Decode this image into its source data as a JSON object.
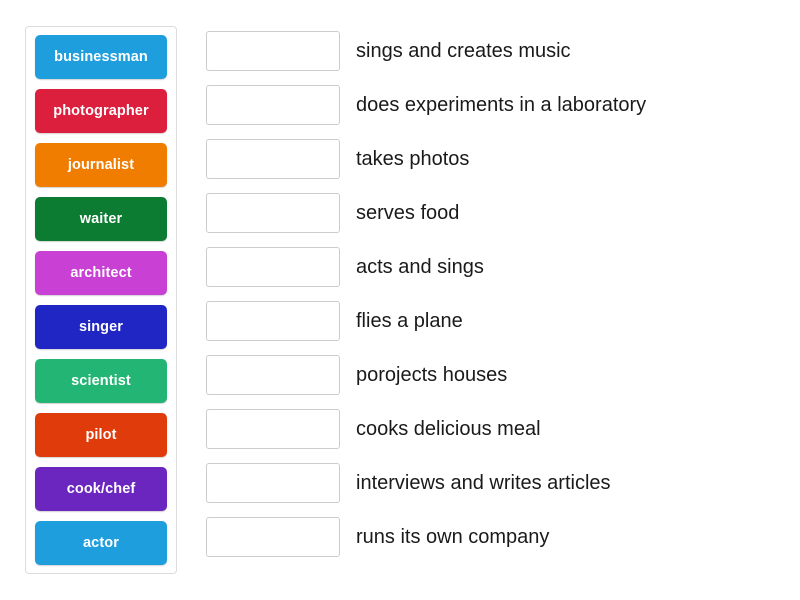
{
  "activity": {
    "type": "match-up",
    "tiles_panel_label": "draggable answer tiles",
    "tiles": [
      {
        "label": "businessman",
        "color": "#1f9ede"
      },
      {
        "label": "photographer",
        "color": "#dc1f3d"
      },
      {
        "label": "journalist",
        "color": "#f07d00"
      },
      {
        "label": "waiter",
        "color": "#0c7c32"
      },
      {
        "label": "architect",
        "color": "#c940d5"
      },
      {
        "label": "singer",
        "color": "#2026c4"
      },
      {
        "label": "scientist",
        "color": "#22b573"
      },
      {
        "label": "pilot",
        "color": "#e03b0b"
      },
      {
        "label": "cook/chef",
        "color": "#6b26bf"
      },
      {
        "label": "actor",
        "color": "#1f9ede"
      }
    ],
    "rows": [
      {
        "answer": "",
        "definition": "sings and creates music"
      },
      {
        "answer": "",
        "definition": "does experiments in a laboratory"
      },
      {
        "answer": "",
        "definition": "takes photos"
      },
      {
        "answer": "",
        "definition": "serves food"
      },
      {
        "answer": "",
        "definition": "acts and sings"
      },
      {
        "answer": "",
        "definition": "flies a plane"
      },
      {
        "answer": "",
        "definition": "porojects houses"
      },
      {
        "answer": "",
        "definition": "cooks delicious meal"
      },
      {
        "answer": "",
        "definition": "interviews and writes articles"
      },
      {
        "answer": "",
        "definition": "runs its own company"
      }
    ],
    "colors": {
      "page_background": "#ffffff",
      "panel_border": "#dcdcdc",
      "dropzone_border": "#cccccc",
      "definition_text": "#1a1a1a",
      "tile_text": "#ffffff"
    }
  }
}
